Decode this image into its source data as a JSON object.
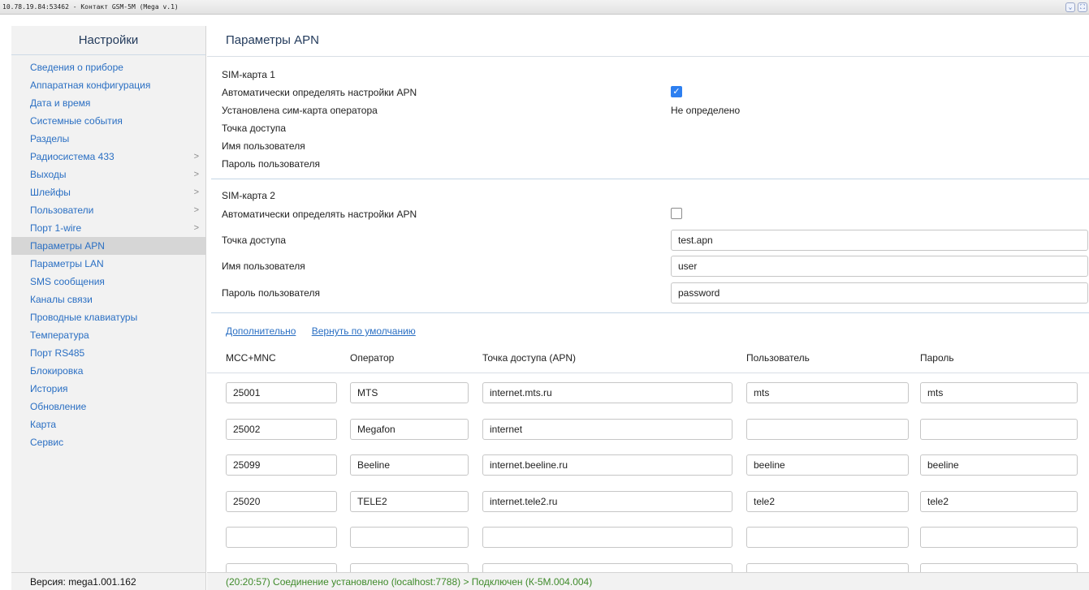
{
  "window": {
    "title": "10.78.19.84:53462 - Контакт GSM-5M (Mega v.1)",
    "controls": [
      "⌄",
      "⛶"
    ]
  },
  "sidebar": {
    "title": "Настройки",
    "items": [
      {
        "label": "Сведения о приборе",
        "submenu": false
      },
      {
        "label": "Аппаратная конфигурация",
        "submenu": false
      },
      {
        "label": "Дата и время",
        "submenu": false
      },
      {
        "label": "Системные события",
        "submenu": false
      },
      {
        "label": "Разделы",
        "submenu": false
      },
      {
        "label": "Радиосистема 433",
        "submenu": true
      },
      {
        "label": "Выходы",
        "submenu": true
      },
      {
        "label": "Шлейфы",
        "submenu": true
      },
      {
        "label": "Пользователи",
        "submenu": true
      },
      {
        "label": "Порт 1-wire",
        "submenu": true
      },
      {
        "label": "Параметры APN",
        "submenu": false,
        "active": true
      },
      {
        "label": "Параметры LAN",
        "submenu": false
      },
      {
        "label": "SMS сообщения",
        "submenu": false
      },
      {
        "label": "Каналы связи",
        "submenu": false
      },
      {
        "label": "Проводные клавиатуры",
        "submenu": false
      },
      {
        "label": "Температура",
        "submenu": false
      },
      {
        "label": "Порт RS485",
        "submenu": false
      },
      {
        "label": "Блокировка",
        "submenu": false
      },
      {
        "label": "История",
        "submenu": false
      },
      {
        "label": "Обновление",
        "submenu": false
      },
      {
        "label": "Карта",
        "submenu": false
      },
      {
        "label": "Сервис",
        "submenu": false
      }
    ],
    "chevron": ">",
    "version": "Версия: mega1.001.162"
  },
  "main": {
    "title": "Параметры APN",
    "sim1": {
      "header": "SIM-карта 1",
      "auto_label": "Автоматически определять настройки APN",
      "auto_checked": true,
      "check_mark": "✓",
      "operator_label": "Установлена сим-карта оператора",
      "operator_value": "Не определено",
      "apn_label": "Точка доступа",
      "user_label": "Имя пользователя",
      "password_label": "Пароль пользователя"
    },
    "sim2": {
      "header": "SIM-карта 2",
      "auto_label": "Автоматически определять настройки APN",
      "auto_checked": false,
      "apn_label": "Точка доступа",
      "apn_value": "test.apn",
      "user_label": "Имя пользователя",
      "user_value": "user",
      "password_label": "Пароль пользователя",
      "password_value": "password"
    },
    "links": {
      "advanced": "Дополнительно",
      "reset": "Вернуть по умолчанию"
    },
    "table": {
      "headers": [
        "MCC+MNC",
        "Оператор",
        "Точка доступа (APN)",
        "Пользователь",
        "Пароль"
      ],
      "rows": [
        [
          "25001",
          "MTS",
          "internet.mts.ru",
          "mts",
          "mts"
        ],
        [
          "25002",
          "Megafon",
          "internet",
          "",
          ""
        ],
        [
          "25099",
          "Beeline",
          "internet.beeline.ru",
          "beeline",
          "beeline"
        ],
        [
          "25020",
          "TELE2",
          "internet.tele2.ru",
          "tele2",
          "tele2"
        ],
        [
          "",
          "",
          "",
          "",
          ""
        ],
        [
          "",
          "",
          "",
          "",
          ""
        ]
      ]
    }
  },
  "status": "(20:20:57) Соединение установлено (localhost:7788) > Подключен (К-5М.004.004)"
}
